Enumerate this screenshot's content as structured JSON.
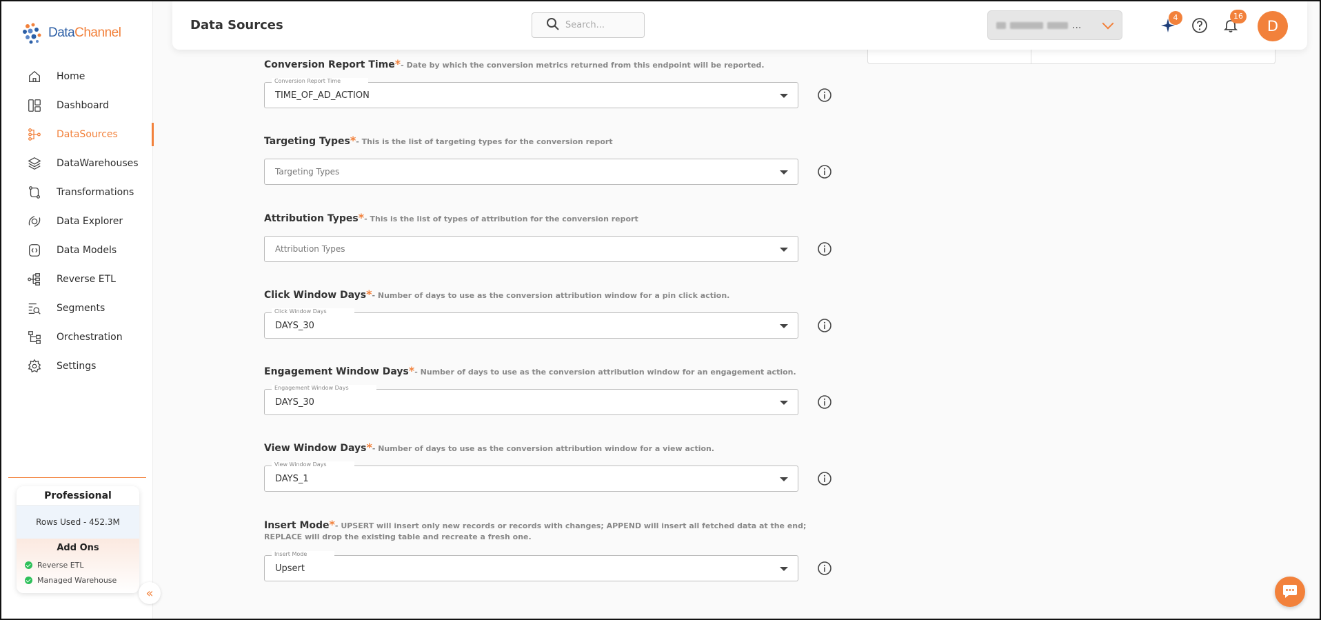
{
  "app": {
    "logo_text_a": "Data",
    "logo_text_b": "Channel"
  },
  "sidebar": {
    "items": [
      {
        "label": "Home",
        "icon": "home-icon"
      },
      {
        "label": "Dashboard",
        "icon": "dashboard-icon"
      },
      {
        "label": "DataSources",
        "icon": "datasources-icon",
        "active": true
      },
      {
        "label": "DataWarehouses",
        "icon": "datawarehouses-icon"
      },
      {
        "label": "Transformations",
        "icon": "transformations-icon"
      },
      {
        "label": "Data Explorer",
        "icon": "data-explorer-icon"
      },
      {
        "label": "Data Models",
        "icon": "data-models-icon"
      },
      {
        "label": "Reverse ETL",
        "icon": "reverse-etl-icon"
      },
      {
        "label": "Segments",
        "icon": "segments-icon"
      },
      {
        "label": "Orchestration",
        "icon": "orchestration-icon"
      },
      {
        "label": "Settings",
        "icon": "settings-icon"
      }
    ],
    "plan": {
      "title": "Professional",
      "rows_used": "Rows Used - 452.3M",
      "addons_title": "Add Ons",
      "addons": [
        "Reverse ETL",
        "Managed Warehouse"
      ]
    },
    "collapse_glyph": "«"
  },
  "header": {
    "title": "Data Sources",
    "search_placeholder": "Search...",
    "workspace_suffix": "...",
    "ai_badge": "4",
    "notifications_badge": "16",
    "avatar_initial": "D"
  },
  "form": {
    "fields": [
      {
        "label": "Conversion Report Time",
        "desc": "- Date by which the conversion metrics returned from this endpoint will be reported.",
        "floating_label": "Conversion Report Time",
        "value": "TIME_OF_AD_ACTION",
        "placeholder": ""
      },
      {
        "label": "Targeting Types",
        "desc": "- This is the list of targeting types for the conversion report",
        "floating_label": "",
        "value": "",
        "placeholder": "Targeting Types"
      },
      {
        "label": "Attribution Types",
        "desc": "- This is the list of types of attribution for the conversion report",
        "floating_label": "",
        "value": "",
        "placeholder": "Attribution Types"
      },
      {
        "label": "Click Window Days",
        "desc": "- Number of days to use as the conversion attribution window for a pin click action.",
        "floating_label": "Click Window Days",
        "value": "DAYS_30",
        "placeholder": ""
      },
      {
        "label": "Engagement Window Days",
        "desc": "- Number of days to use as the conversion attribution window for an engagement action.",
        "floating_label": "Engagement Window Days",
        "value": "DAYS_30",
        "placeholder": ""
      },
      {
        "label": "View Window Days",
        "desc": "- Number of days to use as the conversion attribution window for a view action.",
        "floating_label": "View Window Days",
        "value": "DAYS_1",
        "placeholder": ""
      },
      {
        "label": "Insert Mode",
        "desc": "- UPSERT will insert only new records or records with changes; APPEND will insert all fetched data at the end;",
        "desc2": "REPLACE will drop the existing table and recreate a fresh one.",
        "floating_label": "Insert Mode",
        "value": "Upsert",
        "placeholder": ""
      }
    ],
    "required_marker": "*"
  },
  "colors": {
    "accent": "#f2813b",
    "brand_blue": "#2d5fa6",
    "success": "#2ec05a"
  }
}
